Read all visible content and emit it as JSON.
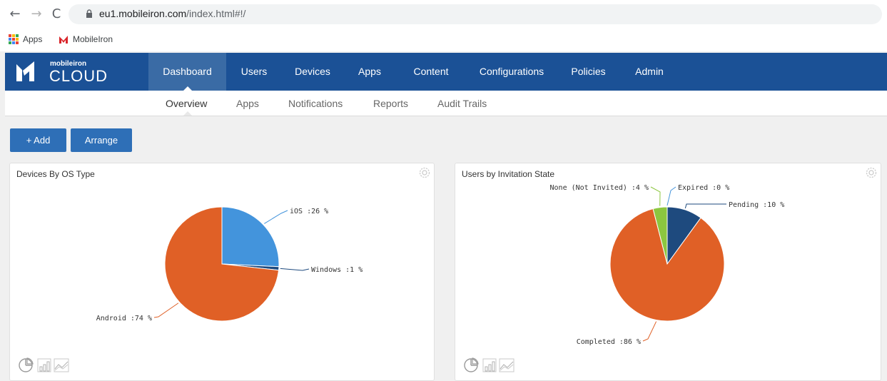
{
  "browser": {
    "url_host": "eu1.mobileiron.com",
    "url_path": "/index.html#!/",
    "bookmarks": [
      {
        "label": "Apps",
        "icon": "apps-grid-icon"
      },
      {
        "label": "MobileIron",
        "icon": "mobileiron-favicon"
      }
    ]
  },
  "header": {
    "logo_small": "mobileiron",
    "logo_big": "CLOUD",
    "tabs": [
      {
        "label": "Dashboard",
        "active": true
      },
      {
        "label": "Users"
      },
      {
        "label": "Devices"
      },
      {
        "label": "Apps"
      },
      {
        "label": "Content"
      },
      {
        "label": "Configurations"
      },
      {
        "label": "Policies"
      },
      {
        "label": "Admin"
      }
    ]
  },
  "subnav": {
    "tabs": [
      {
        "label": "Overview",
        "active": true
      },
      {
        "label": "Apps"
      },
      {
        "label": "Notifications"
      },
      {
        "label": "Reports"
      },
      {
        "label": "Audit Trails"
      }
    ]
  },
  "actions": {
    "add_label": "+ Add",
    "arrange_label": "Arrange"
  },
  "colors": {
    "header_bg": "#1b5196",
    "button_bg": "#2e6fb7",
    "orange": "#e06026",
    "blue": "#4394dc",
    "dark_blue": "#1e4a7e",
    "green": "#8cc63f"
  },
  "chart_data": [
    {
      "type": "pie",
      "title": "Devices By OS Type",
      "series": [
        {
          "name": "iOS",
          "value": 26,
          "label": "iOS :26 %",
          "color": "#4394dc"
        },
        {
          "name": "Windows",
          "value": 1,
          "label": "Windows :1 %",
          "color": "#1e4a7e"
        },
        {
          "name": "Android",
          "value": 74,
          "label": "Android :74 %",
          "color": "#e06026"
        }
      ]
    },
    {
      "type": "pie",
      "title": "Users by Invitation State",
      "series": [
        {
          "name": "Expired",
          "value": 0,
          "label": "Expired :0 %",
          "color": "#4394dc"
        },
        {
          "name": "Pending",
          "value": 10,
          "label": "Pending :10 %",
          "color": "#1e4a7e"
        },
        {
          "name": "Completed",
          "value": 86,
          "label": "Completed :86 %",
          "color": "#e06026"
        },
        {
          "name": "None (Not Invited)",
          "value": 4,
          "label": "None (Not Invited) :4 %",
          "color": "#8cc63f"
        }
      ]
    }
  ]
}
